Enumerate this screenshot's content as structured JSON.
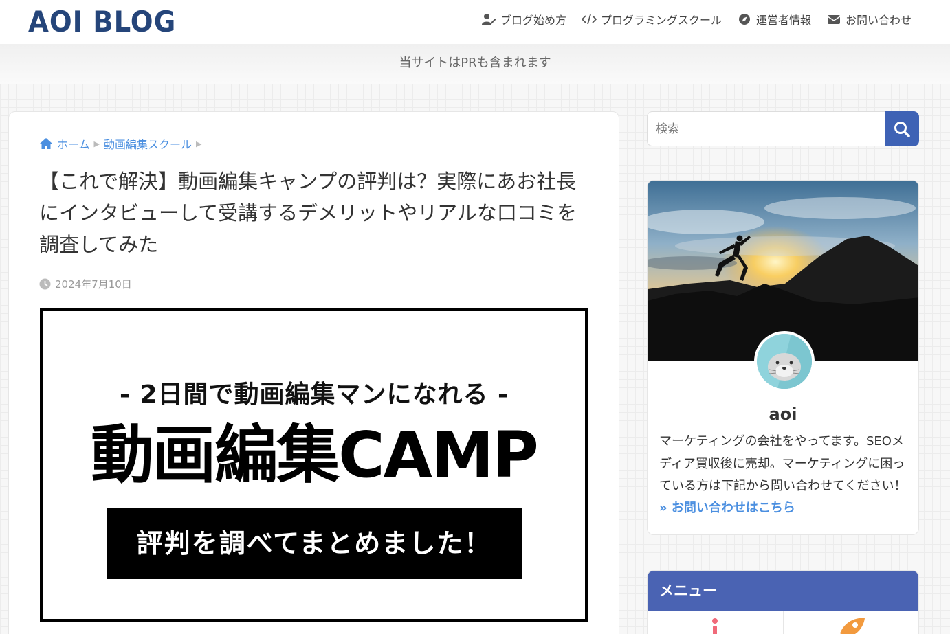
{
  "header": {
    "logo": "AOI BLOG",
    "nav": [
      {
        "label": "ブログ始め方",
        "icon": "user-edit-icon"
      },
      {
        "label": "プログラミングスクール",
        "icon": "code-icon"
      },
      {
        "label": "運営者情報",
        "icon": "compass-icon"
      },
      {
        "label": "お問い合わせ",
        "icon": "envelope-icon"
      }
    ]
  },
  "pr_notice": "当サイトはPRも含まれます",
  "breadcrumb": {
    "home": "ホーム",
    "category": "動画編集スクール"
  },
  "article": {
    "title": "【これで解決】動画編集キャンプの評判は？実際にあお社長にインタビューして受講するデメリットやリアルな口コミを調査してみた",
    "date": "2024年7月10日",
    "eyecatch": {
      "subtitle": "- 2日間で動画編集マンになれる -",
      "main": "動画編集CAMP",
      "box": "評判を調べてまとめました！"
    }
  },
  "sidebar": {
    "search_placeholder": "検索",
    "profile": {
      "name": "aoi",
      "description": "マーケティングの会社をやってます。SEOメディア買収後に売却。マーケティングに困っている方は下記から問い合わせてください！",
      "link": "» お問い合わせはこちら"
    },
    "menu_title": "メニュー"
  },
  "colors": {
    "logo": "#25457a",
    "accent": "#3e62b5",
    "link": "#4b8fe0",
    "menu_header": "#4a63b3"
  }
}
